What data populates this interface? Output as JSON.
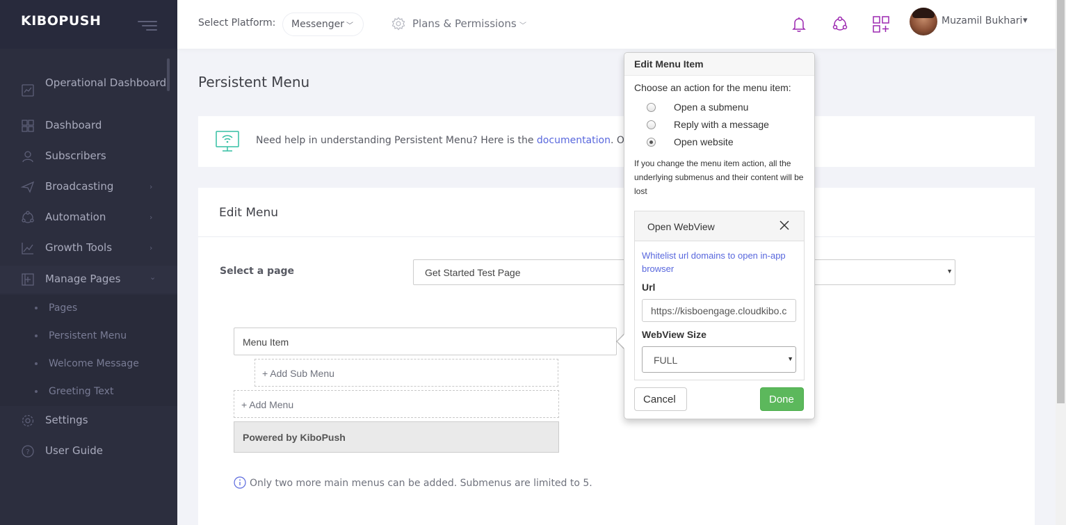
{
  "sidebar": {
    "brand": "KIBOPUSH",
    "items": [
      {
        "label": "Operational Dashboard",
        "icon": "chart-icon"
      },
      {
        "label": "Dashboard",
        "icon": "grid-icon"
      },
      {
        "label": "Subscribers",
        "icon": "user-icon"
      },
      {
        "label": "Broadcasting",
        "icon": "send-icon",
        "arrow": "›"
      },
      {
        "label": "Automation",
        "icon": "automation-icon",
        "arrow": "›"
      },
      {
        "label": "Growth Tools",
        "icon": "growth-icon",
        "arrow": "›"
      },
      {
        "label": "Manage Pages",
        "icon": "pages-icon",
        "arrow": "⌄"
      },
      {
        "label": "Settings",
        "icon": "gear-icon"
      },
      {
        "label": "User Guide",
        "icon": "help-icon"
      }
    ],
    "subitems": [
      "Pages",
      "Persistent Menu",
      "Welcome Message",
      "Greeting Text"
    ]
  },
  "topbar": {
    "platform_label": "Select Platform:",
    "platform_value": "Messenger",
    "plans_label": "Plans & Permissions",
    "user_name": "Muzamil Bukhari"
  },
  "main": {
    "title": "Persistent Menu",
    "help_text_before": "Need help in understanding Persistent Menu? Here is the ",
    "help_link": "documentation",
    "help_text_after": ". Or c",
    "edit_title": "Edit Menu",
    "select_page_label": "Select a page",
    "selected_page": "Get Started Test Page",
    "menu_item": "Menu Item",
    "add_sub_menu": "+ Add Sub Menu",
    "add_menu": "+ Add Menu",
    "powered_by": "Powered by KiboPush",
    "note": "Only two more main menus can be added. Submenus are limited to 5."
  },
  "popover": {
    "title": "Edit Menu Item",
    "prompt": "Choose an action for the menu item:",
    "options": [
      {
        "label": "Open a submenu",
        "checked": false
      },
      {
        "label": "Reply with a message",
        "checked": false
      },
      {
        "label": "Open website",
        "checked": true
      }
    ],
    "warning": "If you change the menu item action, all the underlying submenus and their content will be lost",
    "webview": {
      "title": "Open WebView",
      "whitelist_link": "Whitelist url domains to open in-app browser",
      "url_label": "Url",
      "url_value": "https://kisboengage.cloudkibo.c",
      "size_label": "WebView Size",
      "size_value": "FULL"
    },
    "cancel": "Cancel",
    "done": "Done"
  },
  "colors": {
    "sidebar_bg": "#2c2e3e",
    "accent_purple": "#9c27b0",
    "link_blue": "#5867dd",
    "done_green": "#5cb85c"
  }
}
